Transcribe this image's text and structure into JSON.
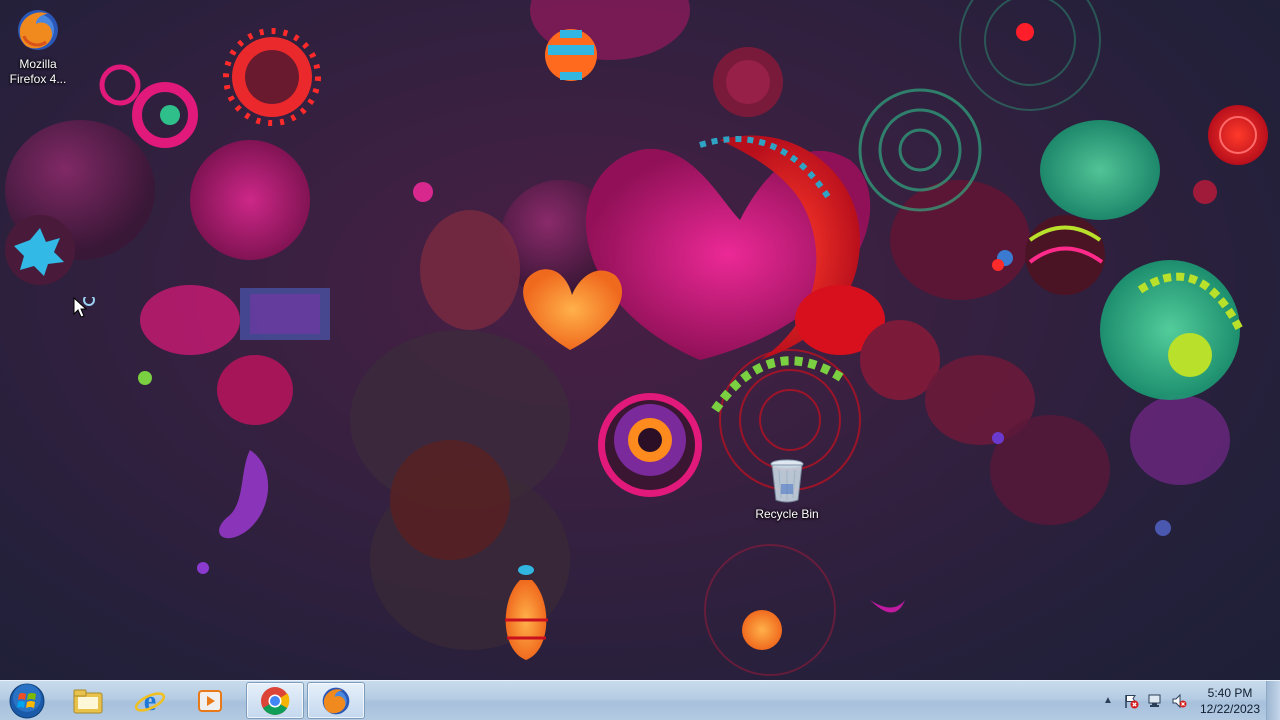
{
  "desktop": {
    "icons": [
      {
        "id": "firefox",
        "label": "Mozilla Firefox 4...",
        "icon": "firefox-icon"
      },
      {
        "id": "recycle",
        "label": "Recycle Bin",
        "icon": "recycle-bin-icon"
      }
    ]
  },
  "taskbar": {
    "start": {
      "icon": "windows-logo-icon"
    },
    "pinned": [
      {
        "id": "explorer",
        "icon": "folder-icon",
        "active": false
      },
      {
        "id": "ie",
        "icon": "internet-explorer-icon",
        "active": false
      },
      {
        "id": "media",
        "icon": "media-player-icon",
        "active": false
      },
      {
        "id": "chrome",
        "icon": "chrome-icon",
        "active": true
      },
      {
        "id": "firefox",
        "icon": "firefox-icon",
        "active": true
      }
    ],
    "tray": {
      "icons": [
        "chevron-up-icon",
        "flag-icon",
        "network-icon",
        "speaker-muted-icon"
      ],
      "time": "5:40 PM",
      "date": "12/22/2023"
    }
  },
  "colors": {
    "taskbar": "#b4cbe2",
    "wallpaper_base": "#2a2040",
    "accent_pink": "#e0197a",
    "accent_red": "#e5151b",
    "accent_teal": "#2fbf8a"
  }
}
